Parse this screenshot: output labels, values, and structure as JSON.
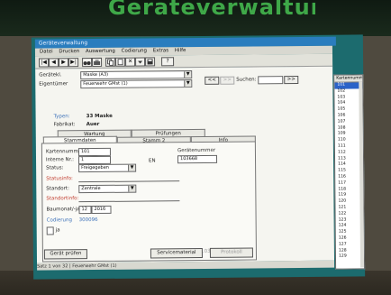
{
  "room_heading": "Geräteverwaltung",
  "window": {
    "title": "Geräteverwaltung"
  },
  "menu": [
    "Datei",
    "Drucken",
    "Auswertung",
    "Codierung",
    "Extras",
    "Hilfe"
  ],
  "toolbar": {
    "first": "|◀",
    "prev": "◀",
    "next": "▶",
    "last": "▶|",
    "delete": "✕",
    "save": "💾",
    "help": "?"
  },
  "header": {
    "geraetekl_label": "Gerätekl.",
    "geraetekl_value": "Maske (A3)",
    "eigentuemer_label": "Eigentümer",
    "eigentuemer_value": "Feuerwehr GMst (1)",
    "nav_back": "<<",
    "nav_fwd": ">>",
    "search_label": "Suchen:",
    "search_value": ""
  },
  "info": {
    "typ_label": "Typen:",
    "typ_value": "33 Maske",
    "fabrikat_label": "Fabrikat:",
    "fabrikat_value": "Auer"
  },
  "tabs_upper": [
    "Wartung",
    "Prüfungen"
  ],
  "tabs_lower": [
    "Stammdaten",
    "Stamm 2",
    "Info"
  ],
  "form": {
    "kartennummer_label": "Kartennummer:",
    "kartennummer_value": "101",
    "interne_label": "Interne Nr.:",
    "interne_value": "1",
    "status_label": "Status:",
    "status_value": "Freigegeben",
    "statusinfo_label": "Statusinfo:",
    "standort_label": "Standort:",
    "standort_value": "Zentrale",
    "standortinfo_label": "Standortinfo:",
    "baumonat_label": "Baumonat/-jahr:",
    "baumonat_month": "12",
    "baumonat_year": "2016",
    "codierung_label": "Codierung",
    "codierung_value": "300096",
    "checkbox_label": "ja",
    "geraetenummer_label": "Gerätenummer",
    "geraetenummer_value": "103668",
    "en_label": "EN",
    "timestamp": "13.03.2017 20:18:46"
  },
  "bottom_buttons": [
    "Gerät prüfen",
    "Servicematerial",
    "Protokoll"
  ],
  "status_text": "Satz 1 von 32  |  Feuerwehr GMst (1)",
  "side": {
    "header": "Kartennummer",
    "items": [
      "101",
      "102",
      "103",
      "104",
      "105",
      "106",
      "107",
      "108",
      "109",
      "110",
      "111",
      "112",
      "113",
      "114",
      "115",
      "116",
      "117",
      "118",
      "119",
      "120",
      "121",
      "122",
      "123",
      "124",
      "125",
      "126",
      "127",
      "128",
      "129"
    ]
  },
  "colors": {
    "titlebar": "#2a7dbe",
    "selection": "#2a62c8",
    "heading": "#47c052",
    "screen_frame": "#1c6b6e"
  }
}
